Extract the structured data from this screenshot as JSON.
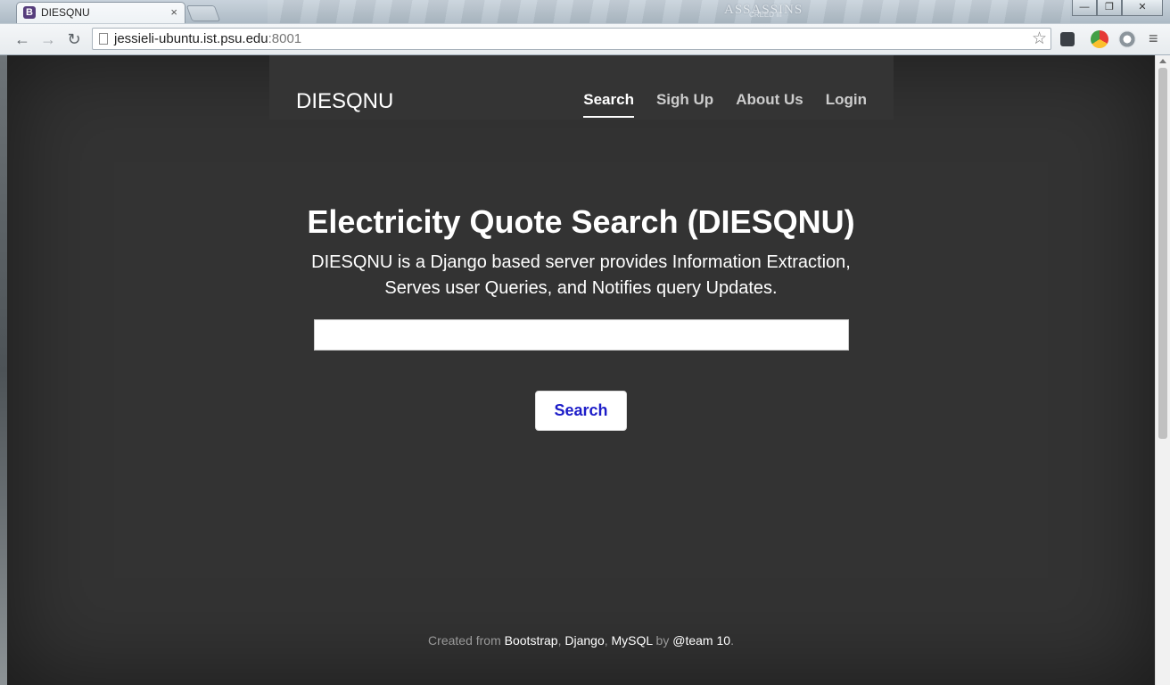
{
  "browser": {
    "tab_title": "DIESQNU",
    "tab_favicon_letter": "B",
    "tab_close": "×",
    "url_host": "jessieli-ubuntu.ist.psu.edu",
    "url_port": ":8001",
    "wallpaper_text": "ASSASSINS",
    "wallpaper_subtext": "CREED III",
    "back": "←",
    "forward": "→",
    "reload": "↻",
    "star": "☆",
    "menu": "≡",
    "minimize": "—",
    "maximize": "❐",
    "close": "✕"
  },
  "site": {
    "brand": "DIESQNU",
    "nav": [
      {
        "label": "Search",
        "active": true
      },
      {
        "label": "Sigh Up",
        "active": false
      },
      {
        "label": "About Us",
        "active": false
      },
      {
        "label": "Login",
        "active": false
      }
    ],
    "heading": "Electricity Quote Search (DIESQNU)",
    "lead": "DIESQNU is a Django based server provides Information Extraction, Serves user Queries, and Notifies query Updates.",
    "search_value": "",
    "search_button": "Search",
    "footer": {
      "created_from": "Created from ",
      "bootstrap": "Bootstrap",
      "sep1": ", ",
      "django": "Django",
      "sep2": ", ",
      "mysql": "MySQL",
      "by": " by ",
      "team": "@team 10",
      "end": "."
    }
  },
  "colors": {
    "page_background": "#333333",
    "search_button_text": "#1c1cc8"
  }
}
